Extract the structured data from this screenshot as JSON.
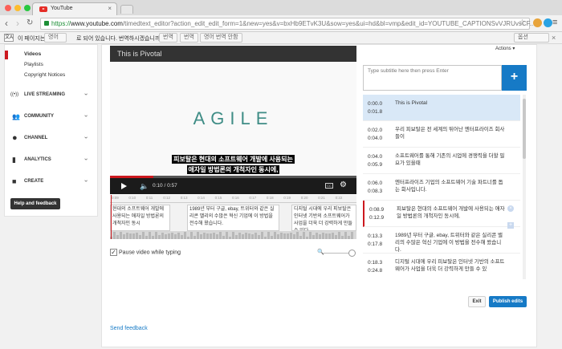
{
  "browser": {
    "tab_title": "YouTube",
    "tab_close": "×",
    "url_scheme": "https://",
    "url_host": "www.youtube.com",
    "url_path": "/timedtext_editor?action_edit_edit_form=1&new=yes&v=bxHb9ETvK3U&sow=yes&ui=hd&bl=vmp&edit_id=YOUTUBE_CAPTIONSvVJRUvsCF...",
    "nav_back": "‹",
    "nav_forward": "›",
    "nav_reload": "↻",
    "bookmark_star": "☆",
    "menu": "≡"
  },
  "translate_bar": {
    "icon": "文A",
    "prefix": "이 페이지는",
    "language": "영어",
    "question": "로 되어 있습니다. 번역하시겠습니까?",
    "btn_translate_short": "번역",
    "btn_translate": "번역",
    "btn_never": "영어 번역 안함",
    "options": "옵션",
    "close": "×"
  },
  "sidebar": {
    "sub_items": [
      "Videos",
      "Playlists",
      "Copyright Notices"
    ],
    "sections": [
      {
        "label": "LIVE STREAMING",
        "icon": "((•))"
      },
      {
        "label": "COMMUNITY",
        "icon": "👥"
      },
      {
        "label": "CHANNEL",
        "icon": "●"
      },
      {
        "label": "ANALYTICS",
        "icon": "▮"
      },
      {
        "label": "CREATE",
        "icon": "■"
      }
    ],
    "chevron": "›",
    "help_button": "Help and feedback"
  },
  "video": {
    "title": "This is Pivotal",
    "logo_text": "AGILE",
    "caption_line1": "피보탈은 현대의 소프트웨어 개발에 사용되는",
    "caption_line2": "애자일 방법론의 개척자인 동시에,",
    "time": "0:10 / 0:57",
    "progress_fraction": 0.175,
    "cc": "CC",
    "gear": "⚙",
    "volume": "🔈"
  },
  "timeline": {
    "ticks": [
      "0:09",
      "0:10",
      "0:11",
      "0:12",
      "0:13",
      "0:14",
      "0:15",
      "0:16",
      "0:17",
      "0:18",
      "0:19",
      "0:20",
      "0:21",
      "0:22"
    ],
    "blocks": [
      {
        "text": "현대의 소프트웨어 개발에 사용되는 애자일 방법론의 개척자인 동시"
      },
      {
        "text": "1989년 부터 구글, ebay, 트위터와 같은 실리콘 밸리의 수많은 혁신 기업에 이 방법을 전수해 왔습니다."
      },
      {
        "text": "디지털 시대에 우리 피보탈은 인터넷 기반의 소프트웨어가 사업을 더욱 더 강력하게 만들 수 있다"
      }
    ]
  },
  "controls": {
    "pause_label": "Pause video while typing",
    "pause_checked": "✓",
    "zoom_icon": "🔍"
  },
  "editor": {
    "actions_label": "Actions ▾",
    "input_placeholder": "Type subtitle here then press Enter",
    "add_button": "+",
    "delete_icon": "×",
    "add_icon": "+",
    "rows": [
      {
        "start": "0:00.0",
        "end": "0:01.8",
        "text": "This is Pivotal"
      },
      {
        "start": "0:02.0",
        "end": "0:04.0",
        "text": "우리 피보탈은 전 세계의 뛰어난 엔터프라이즈 회사들이"
      },
      {
        "start": "0:04.0",
        "end": "0:05.9",
        "text": "소프트웨어를 통해 기존의 시업에 경쟁력을 더할 필요가 있을때"
      },
      {
        "start": "0:06.0",
        "end": "0:08.3",
        "text": "엔터프라이즈 기업의 소프트웨어 기술 파트너를 돕는 회사입니다."
      },
      {
        "start": "0:08.9",
        "end": "0:12.9",
        "text": "피보탈은 현대의 소프트웨어 개발에 사용되는 애자일 방법론의 개척자인 동시에,"
      },
      {
        "start": "0:13.3",
        "end": "0:17.8",
        "text": "1989년 부터 구글, ebay, 트위터와 같은 실리콘 밸리의 수많은 혁신 기업에 이 방법을 전수해 왔습니다."
      },
      {
        "start": "0:18.3",
        "end": "0:24.8",
        "text": "디지털 시대에 우리 피보탈은 인터넷 기반의 소프트웨어가 사업을 더욱 더 강력하게 만들 수 있"
      }
    ],
    "exit_button": "Exit",
    "publish_button": "Publish edits"
  },
  "footer": {
    "send_feedback": "Send feedback"
  },
  "colors": {
    "accent_blue": "#167ac6",
    "youtube_red": "#cc181e",
    "agile_teal": "#3f8d86"
  }
}
